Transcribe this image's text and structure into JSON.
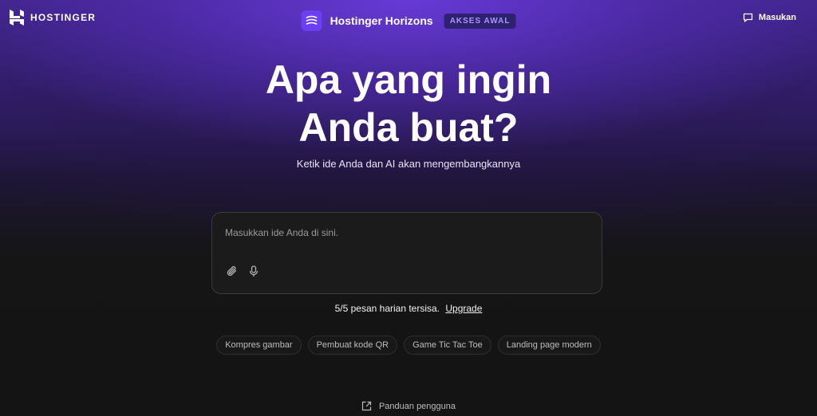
{
  "header": {
    "brand": "HOSTINGER",
    "app_title": "Hostinger Horizons",
    "badge": "AKSES AWAL",
    "feedback_label": "Masukan",
    "icons": {
      "brand": "hostinger-logo",
      "app": "stack-lines-icon",
      "feedback": "chat-icon"
    }
  },
  "hero": {
    "title": "Apa yang ingin Anda buat?",
    "subtitle": "Ketik ide Anda dan AI akan mengembangkannya"
  },
  "prompt": {
    "placeholder": "Masukkan ide Anda di sini.",
    "value": "",
    "tools": [
      "paperclip-icon",
      "microphone-icon"
    ]
  },
  "quota": {
    "text": "5/5 pesan harian tersisa.",
    "upgrade_label": "Upgrade"
  },
  "suggestions": [
    "Kompres gambar",
    "Pembuat kode QR",
    "Game Tic Tac Toe",
    "Landing page modern"
  ],
  "footer": {
    "guide_label": "Panduan pengguna",
    "guide_icon": "external-link-icon"
  },
  "colors": {
    "accent": "#6c3ff2",
    "badge_bg": "#2e2170",
    "badge_text": "#a996ff",
    "background_dark": "#141414"
  }
}
